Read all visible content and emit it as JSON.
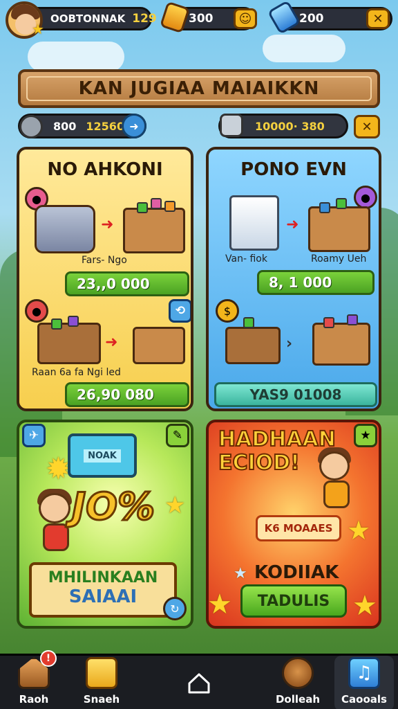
{
  "player": {
    "name": "OOBTONNAK",
    "level": "129"
  },
  "currencies": [
    {
      "icon": "gold-bar-icon",
      "value": "300"
    },
    {
      "icon": "blue-gem-icon",
      "value": "200"
    }
  ],
  "banner": {
    "title": "KAN JUGIAA MAIAIKKN"
  },
  "resources": {
    "left": {
      "text1": "800",
      "text2": "12560"
    },
    "right": {
      "value": "10000· 380"
    }
  },
  "panels": {
    "left": {
      "title": "NO AHKONI",
      "item1_label": "Fars- Ngo",
      "price1": "23,,0 000",
      "item2_label": "Raan 6a fa Ngi led",
      "price2": "26,90 080"
    },
    "right": {
      "title": "PONO EVN",
      "item1_label": "Van- fiok",
      "item2_label": "Roamy Ueh",
      "price1": "8, 1 000",
      "price2": "YAS9 01008"
    }
  },
  "promo_left": {
    "screen_text": "NOAK",
    "percent": "JO%",
    "line1": "MHILINKAAN",
    "line2": "SAIAAI"
  },
  "promo_right": {
    "title_line1": "HADHAAN",
    "title_line2": "ECIOD!",
    "button": "K6 MOAAES",
    "subtitle": "KODIIAK",
    "action": "TADULIS"
  },
  "nav": [
    {
      "label": "Raoh",
      "icon": "house-icon",
      "badge": "!"
    },
    {
      "label": "Snaeh",
      "icon": "cheese-icon"
    },
    {
      "label": "Dolleah",
      "icon": "dog-icon"
    },
    {
      "label": "Caooals",
      "icon": "music-note-icon"
    }
  ]
}
